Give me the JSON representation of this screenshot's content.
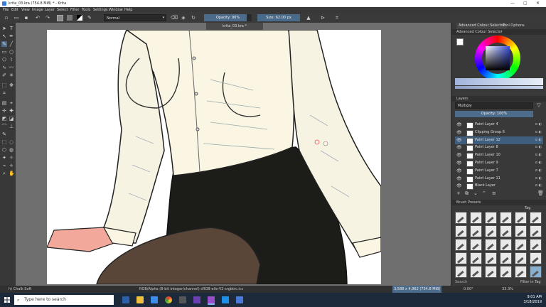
{
  "window": {
    "title": "krita_03.kra (754.8 MiB) * - Krita",
    "controls": [
      "—",
      "▢",
      "✕"
    ]
  },
  "menu": [
    "File",
    "Edit",
    "View",
    "Image",
    "Layer",
    "Select",
    "Filter",
    "Tools",
    "Settings",
    "Window",
    "Help"
  ],
  "toolbar": {
    "blend_mode": "Normal",
    "opacity_label": "Opacity: 90%",
    "opacity_level": 0.9,
    "size_label": "Size: 62.00 px"
  },
  "document_tab": "krita_03.kra *",
  "dock": {
    "tabs": [
      "Advanced Colour Selector",
      "Tool Options"
    ],
    "colour_selector_title": "Advanced Colour Selector",
    "layers_title": "Layers",
    "layers_blend_mode": "Multiply",
    "layers_opacity": "Opacity: 100%",
    "layers": [
      {
        "name": "Paint Layer 4",
        "selected": false
      },
      {
        "name": "Clipping Group 6",
        "selected": false
      },
      {
        "name": "Paint Layer 12",
        "selected": true
      },
      {
        "name": "Paint Layer 8",
        "selected": false
      },
      {
        "name": "Paint Layer 10",
        "selected": false
      },
      {
        "name": "Paint Layer 9",
        "selected": false
      },
      {
        "name": "Paint Layer 7",
        "selected": false
      },
      {
        "name": "Paint Layer 11",
        "selected": false
      },
      {
        "name": "Black Layer",
        "selected": false
      }
    ],
    "brush_presets_title": "Brush Presets",
    "brush_tag_label": "Tag",
    "brush_search_label": "Search",
    "filter_in_tag": "Filter in Tag"
  },
  "status": {
    "brush_name": "h) Chalk Soft",
    "color_info": "RGB/Alpha (8-bit integer/channel)  sRGB-elle-V2-srgbtrc.icc",
    "image_size": "3,588 x 4,962 (754.8 MiB)",
    "rotation": "0.00°",
    "zoom": "33.3%"
  },
  "taskbar": {
    "search_placeholder": "Type here to search",
    "time": "9:01 AM",
    "date": "3/18/2019"
  },
  "colors": {
    "accent": "#3f5d7d",
    "shirt": "#fbf6e3",
    "skirt": "#1c1d19",
    "stocking": "#5a4638",
    "skin": "#f2a99c"
  }
}
